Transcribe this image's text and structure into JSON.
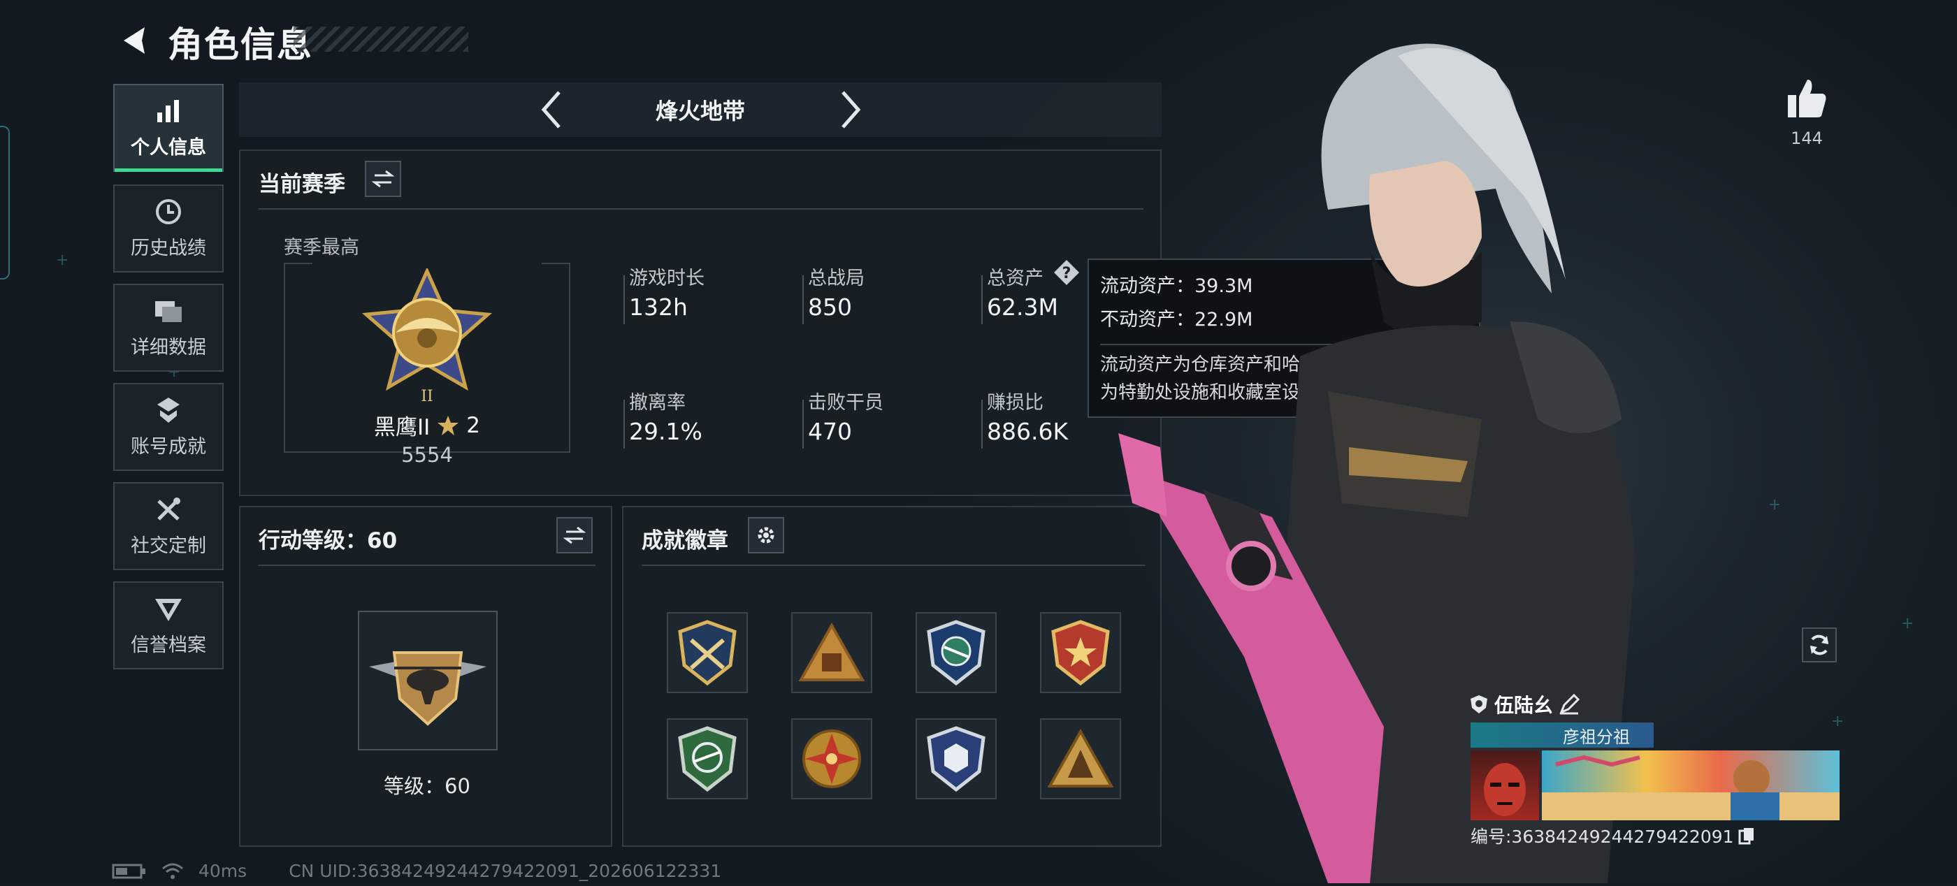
{
  "header": {
    "title": "角色信息",
    "back_icon": "back-arrow-icon"
  },
  "sidebar": {
    "items": [
      {
        "label": "个人信息",
        "icon": "bar-chart-icon",
        "active": true
      },
      {
        "label": "历史战绩",
        "icon": "clock-icon"
      },
      {
        "label": "详细数据",
        "icon": "cards-icon"
      },
      {
        "label": "账号成就",
        "icon": "achievement-icon"
      },
      {
        "label": "社交定制",
        "icon": "tools-icon"
      },
      {
        "label": "信誉档案",
        "icon": "reputation-icon"
      }
    ]
  },
  "mode_selector": {
    "title": "烽火地带"
  },
  "season": {
    "title": "当前赛季",
    "best_label": "赛季最高",
    "rank_name": "黑鹰II",
    "rank_stars": "2",
    "rank_score": "5554",
    "stats": [
      {
        "label": "游戏时长",
        "value": "132h"
      },
      {
        "label": "总战局",
        "value": "850"
      },
      {
        "label": "总资产",
        "value": "62.3M"
      },
      {
        "label": "撤离率",
        "value": "29.1%"
      },
      {
        "label": "击败干员",
        "value": "470"
      },
      {
        "label": "赚损比",
        "value": "886.6K"
      }
    ]
  },
  "tooltip": {
    "liquid": "流动资产：39.3M",
    "fixed": "不动资产：22.9M",
    "desc1": "流动资产为仓库资产和哈夫币，不动资产",
    "desc2": "为特勤处设施和收藏室设施"
  },
  "action_level": {
    "title": "行动等级：60",
    "level_text": "等级：60"
  },
  "achievements": {
    "title": "成就徽章",
    "badge_count": 8
  },
  "likes": {
    "count": "144"
  },
  "player_card": {
    "name": "伍陆幺",
    "group": "彦祖分祖",
    "id": "编号:36384249244279422091"
  },
  "statusbar": {
    "ping": "40ms",
    "uid": "CN UID:36384249244279422091_202606122331"
  },
  "colors": {
    "accent_green": "#3fd68f",
    "gold": "#c9a24a",
    "pink_weapon": "#e06aa8"
  }
}
